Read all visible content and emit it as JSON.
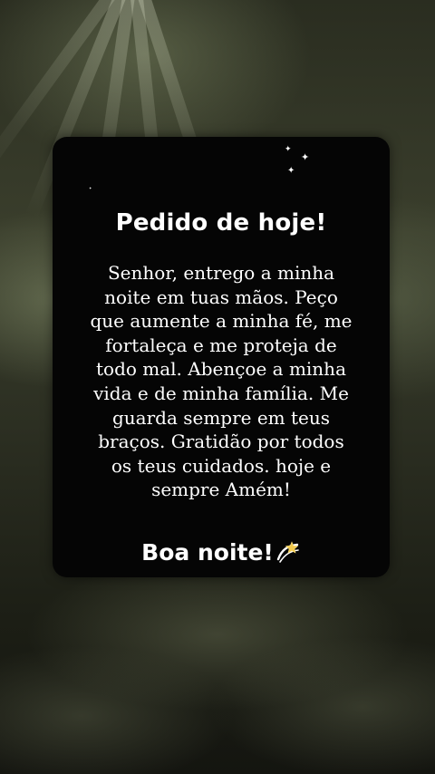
{
  "card": {
    "title": "Pedido de hoje!",
    "message": "Senhor, entrego a minha noite em tuas mãos. Peço que aumente a minha fé, me fortaleça e me proteja de todo mal. Abençoe a minha vida e de minha família. Me guarda sempre em teus braços. Gratidão por todos os teus cuidados. hoje e sempre Amém!",
    "closing": "Boa noite!",
    "closing_icon": "dizzy-star-icon",
    "decoration_icon": "sparkles-icon"
  },
  "colors": {
    "card_background": "#050505",
    "text": "#ffffff",
    "sky_light": "#3a3e2c",
    "sky_dark": "#141510"
  }
}
